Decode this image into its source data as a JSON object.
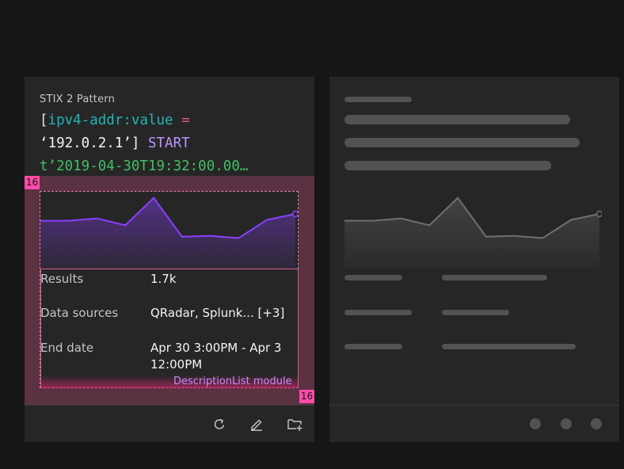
{
  "left_card": {
    "label": "STIX 2 Pattern",
    "code": {
      "line1_bracket": "[",
      "line1_key": "ipv4-addr:value",
      "line1_op": " =",
      "line2_str": "‘192.0.2.1’]",
      "line2_kw": " START",
      "line3_time": "t’2019-04-30T19:32:00.00…"
    },
    "chart_data": {
      "type": "area",
      "values": [
        7,
        7,
        7.5,
        6,
        12,
        3.5,
        3.7,
        3.2,
        7.2,
        8.5
      ]
    },
    "description_list": [
      {
        "term": "Results",
        "description": "1.7k"
      },
      {
        "term": "Data sources",
        "description": "QRadar, Splunk... [+3]"
      },
      {
        "term": "End date",
        "description": "Apr 30 3:00PM - Apr 3 12:00PM"
      }
    ],
    "module_label": "DescriptionList module",
    "spacing_badges": {
      "top_left": "16",
      "bottom_right": "16"
    },
    "toolbar": [
      {
        "name": "refresh-icon"
      },
      {
        "name": "edit-icon"
      },
      {
        "name": "folder-add-icon"
      }
    ]
  },
  "right_card": {
    "state": "loading skeleton",
    "chart_data": {
      "type": "area",
      "values": [
        7,
        7,
        7.5,
        6,
        12,
        3.5,
        3.7,
        3.2,
        7.2,
        8.5
      ]
    }
  },
  "colors": {
    "background": "#161616",
    "card": "#262626",
    "accent_purple": "#8a3ffc",
    "spacing_pink": "#ff4da6",
    "skeleton": "#525252"
  }
}
